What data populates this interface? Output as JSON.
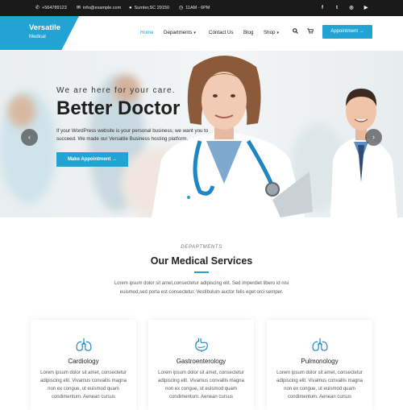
{
  "topbar": {
    "phone": "+564789123",
    "email": "info@example.com",
    "location": "Sumter,SC 29150",
    "hours": "11AM - 6PM",
    "social": [
      "f",
      "t",
      "ig",
      "yt"
    ]
  },
  "header": {
    "logo_title": "Versatile",
    "logo_subtitle": "Medical",
    "nav": [
      {
        "label": "Home"
      },
      {
        "label": "Departments"
      },
      {
        "label": "Contact Us"
      },
      {
        "label": "Blog"
      },
      {
        "label": "Shop"
      }
    ],
    "appointment_button": "Appointment →"
  },
  "hero": {
    "tagline": "We are here for your care.",
    "title": "Better Doctor",
    "text": "If your WordPress website is your personal business, we want you to succeed. We made our Versatile Business hosting platform.",
    "button": "Make Appointment →",
    "slide_count": 5,
    "active_slide": 1
  },
  "services": {
    "label": "DEPARTMENTS",
    "title": "Our Medical Services",
    "description": "Lorem ipsum dolor sit amet,consectetur adipiscing elit. Sed imperdiet libero id nisi euismod,sed porta est consectetur. Vestibulum auctor felis eget orci semper.",
    "cards": [
      {
        "icon": "lungs-icon",
        "title": "Cardiology",
        "text": "Lorem ipsum dolor sit amet, consectetur adipiscing elit. Vivamus convallis magna non ex congue, ut euismod quam condimentum. Aenean cursus"
      },
      {
        "icon": "stomach-icon",
        "title": "Gastroenterology",
        "text": "Lorem ipsum dolor sit amet, consectetur adipiscing elit. Vivamus convallis magna non ex congue, ut euismod quam condimentum. Aenean cursus"
      },
      {
        "icon": "lungs-icon",
        "title": "Pulmonology",
        "text": "Lorem ipsum dolor sit amet, consectetur adipiscing elit. Vivamus convallis magna non ex congue, ut euismod quam condimentum. Aenean cursus"
      }
    ]
  },
  "colors": {
    "accent": "#21a4d3",
    "topbar": "#1a1a1a"
  }
}
